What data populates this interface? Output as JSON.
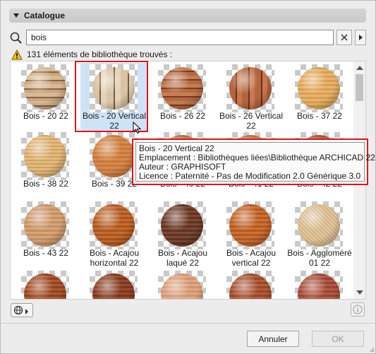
{
  "section": {
    "title": "Catalogue"
  },
  "search": {
    "value": "bois",
    "placeholder": ""
  },
  "results": {
    "text": "131 éléments de bibliothèque trouvés :"
  },
  "tiles": [
    {
      "label": "Bois - 20 22",
      "tone": "stripes-pale"
    },
    {
      "label": "Bois - 20 Vertical 22",
      "tone": "vertical-pale",
      "selected": true
    },
    {
      "label": "Bois - 26 22",
      "tone": "stripes-red"
    },
    {
      "label": "Bois - 26 Vertical 22",
      "tone": "vertical-red"
    },
    {
      "label": "Bois - 37 22",
      "tone": "honey"
    },
    {
      "label": "Bois - 38 22",
      "tone": "light-oak"
    },
    {
      "label": "Bois - 39 22",
      "tone": "orange"
    },
    {
      "label": "Bois - 40 22",
      "tone": "medium"
    },
    {
      "label": "Bois - 41 22",
      "tone": "teak"
    },
    {
      "label": "Bois - 42 22",
      "tone": "cherry"
    },
    {
      "label": "Bois - 43 22",
      "tone": "tan"
    },
    {
      "label": "Bois - Acajou horizontal 22",
      "tone": "acajou"
    },
    {
      "label": "Bois - Acajou laqué 22",
      "tone": "dark-brown"
    },
    {
      "label": "Bois - Acajou vertical 22",
      "tone": "orange-red"
    },
    {
      "label": "Bois - Aggloméré 01 22",
      "tone": "cream"
    },
    {
      "label": "",
      "tone": "mahogany"
    },
    {
      "label": "",
      "tone": "mahogany-deep"
    },
    {
      "label": "",
      "tone": "peach"
    },
    {
      "label": "",
      "tone": "rust"
    },
    {
      "label": "",
      "tone": "brick"
    }
  ],
  "tooltip": {
    "name": "Bois - 20 Vertical 22",
    "location": "Emplacement : Bibliothèques liées\\Bibliothèque ARCHICAD 22",
    "author": "Auteur : GRAPHISOFT",
    "license": "Licence : Paternité - Pas de Modification 2.0 Générique 3.0"
  },
  "buttons": {
    "cancel": "Annuler",
    "ok": "OK"
  },
  "colors": {
    "highlight": "#e0141b",
    "selection": "#cfe3f7",
    "header": "#d0d0d0"
  }
}
